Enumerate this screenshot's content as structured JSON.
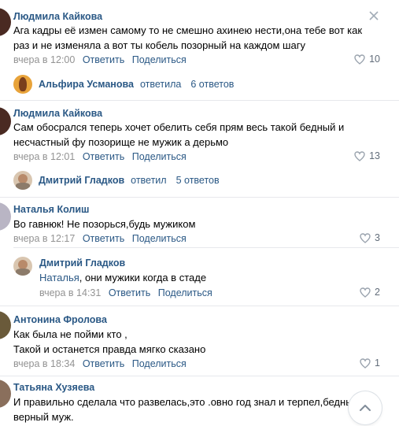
{
  "colors": {
    "link": "#2a5885",
    "meta": "#939393",
    "separator": "#e7e8ec"
  },
  "comments": [
    {
      "author": "Людмила Кайкова",
      "lines": [
        "Ага кадры её измен самому то не смешно ахинею нести,она тебе вот как",
        "раз и не изменяла а вот ты кобель позорный на каждом шагу"
      ],
      "time": "вчера в 12:00",
      "reply": "Ответить",
      "share": "Поделиться",
      "likes": "10",
      "thread": {
        "name": "Альфира Усманова",
        "verb": "ответила",
        "count": "6 ответов"
      }
    },
    {
      "author": "Людмила Кайкова",
      "lines": [
        "Сам обосрался теперь хочет обелить себя прям весь такой бедный и",
        "несчастный фу позорище не мужик а дерьмо"
      ],
      "time": "вчера в 12:01",
      "reply": "Ответить",
      "share": "Поделиться",
      "likes": "13",
      "thread": {
        "name": "Дмитрий Гладков",
        "verb": "ответил",
        "count": "5 ответов"
      }
    },
    {
      "author": "Наталья Колиш",
      "lines": [
        "Во гавнюк! Не позорься,будь мужиком"
      ],
      "time": "вчера в 12:17",
      "reply": "Ответить",
      "share": "Поделиться",
      "likes": "3",
      "nested": {
        "author": "Дмитрий Гладков",
        "mention": "Наталья",
        "text": ", они мужики когда в стаде",
        "time": "вчера в 14:31",
        "reply": "Ответить",
        "share": "Поделиться",
        "likes": "2"
      }
    },
    {
      "author": "Антонина Фролова",
      "lines": [
        "Как была не пойми кто ,",
        "Такой и останется правда мягко сказано"
      ],
      "time": "вчера в 18:34",
      "reply": "Ответить",
      "share": "Поделиться",
      "likes": "1"
    },
    {
      "author": "Татьяна Хузяева",
      "lines": [
        "И правильно сделала что развелась,это .овно год знал и терпел,бедный",
        "верный муж."
      ]
    }
  ],
  "icons": {
    "close": "close-icon",
    "like": "heart-icon",
    "scroll": "chevron-up-icon"
  }
}
